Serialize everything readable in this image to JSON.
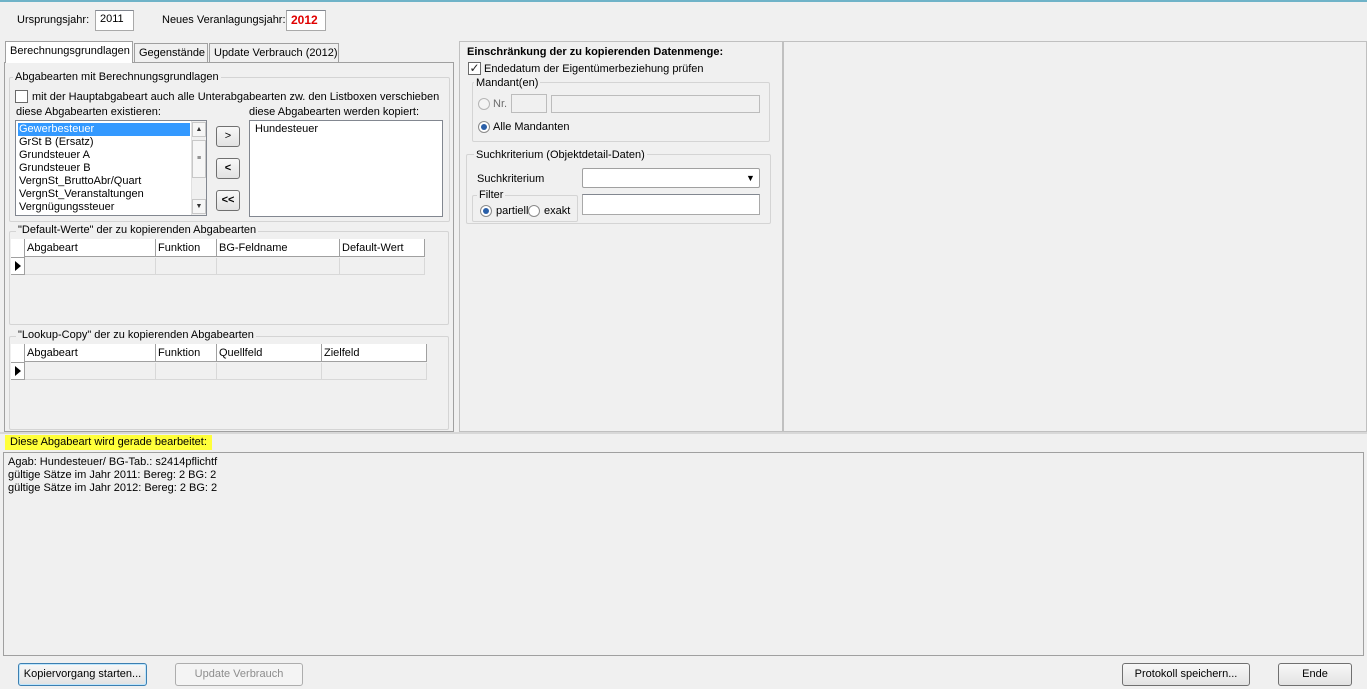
{
  "header": {
    "ursprungsjahr_label": "Ursprungsjahr:",
    "ursprungsjahr_value": "2011",
    "neues_jahr_label": "Neues Veranlagungsjahr:",
    "neues_jahr_value": "2012"
  },
  "tabs": [
    {
      "label": "Berechnungsgrundlagen",
      "active": true
    },
    {
      "label": "Gegenstände",
      "active": false
    },
    {
      "label": "Update Verbrauch (2012)",
      "active": false
    }
  ],
  "abgabearten": {
    "group_title": "Abgabearten mit Berechnungsgrundlagen",
    "checkbox_label": "mit der Hauptabgabeart auch alle Unterabgabearten zw. den Listboxen verschieben",
    "exist_label": "diese Abgabearten existieren:",
    "copy_label": "diese Abgabearten werden kopiert:",
    "exist_items": [
      "Gewerbesteuer",
      "GrSt B (Ersatz)",
      "Grundsteuer A",
      "Grundsteuer B",
      "VergnSt_BruttoAbr/Quart",
      "VergnSt_Veranstaltungen",
      "Vergnügungssteuer"
    ],
    "selected_index": 0,
    "copy_items": [
      "Hundesteuer"
    ],
    "btn_move_right": ">",
    "btn_move_left": "<",
    "btn_move_all_left": "<<"
  },
  "default_werte": {
    "title": "\"Default-Werte\" der zu kopierenden Abgabearten",
    "columns": [
      "Abgabeart",
      "Funktion",
      "BG-Feldname",
      "Default-Wert"
    ]
  },
  "lookup_copy": {
    "title": "\"Lookup-Copy\" der zu kopierenden Abgabearten",
    "columns": [
      "Abgabeart",
      "Funktion",
      "Quellfeld",
      "Zielfeld"
    ]
  },
  "einschraenkung": {
    "title": "Einschränkung der zu kopierenden Datenmenge:",
    "checkbox_label": "Endedatum der Eigentümerbeziehung prüfen",
    "checkbox_checked": true,
    "mandant_group": "Mandant(en)",
    "radio_nr": "Nr.",
    "radio_alle": "Alle Mandanten",
    "suchkriterium_group": "Suchkriterium (Objektdetail-Daten)",
    "suchkriterium_label": "Suchkriterium",
    "suchkriterium_value": "",
    "filter_label": "Filter",
    "filter_partiell": "partiell",
    "filter_exakt": "exakt",
    "filter_value": ""
  },
  "status": {
    "label": "Diese Abgabeart wird gerade bearbeitet:",
    "highlight_color": "#ffff3a",
    "log_lines": [
      "Agab: Hundesteuer/ BG-Tab.: s2414pflichtf",
      "gültige Sätze im Jahr 2011: Bereg: 2 BG: 2",
      "gültige Sätze im Jahr 2012: Bereg: 2 BG: 2"
    ]
  },
  "footer": {
    "start_label": "Kopiervorgang starten...",
    "update_label": "Update Verbrauch",
    "protokoll_label": "Protokoll speichern...",
    "ende_label": "Ende"
  },
  "icons": [
    "chevron-down-icon",
    "scroll-up-icon",
    "scroll-down-icon",
    "row-pointer-icon",
    "check-icon"
  ]
}
